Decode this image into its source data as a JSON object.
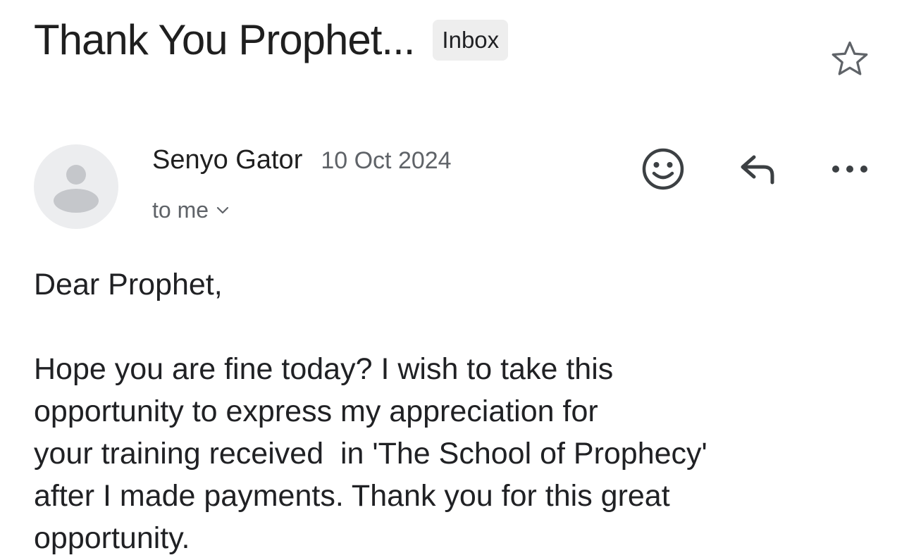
{
  "email": {
    "subject": "Thank You Prophet...",
    "label": "Inbox",
    "sender": {
      "name": "Senyo Gator",
      "date": "10 Oct 2024",
      "recipients": "to me"
    },
    "body": {
      "greeting": "Dear Prophet,",
      "lines": [
        "Hope you are fine today? I wish to take this",
        "opportunity to express my appreciation for",
        "your training received  in 'The School of Prophecy'",
        "after I made payments. Thank you for this great",
        "opportunity."
      ]
    }
  },
  "icons": {
    "star": "star-outline-icon",
    "avatar": "default-avatar-icon",
    "emoji": "add-reaction-icon",
    "reply": "reply-icon",
    "more": "more-horizontal-icon",
    "chevron": "chevron-down-icon"
  },
  "colors": {
    "text_primary": "#1f1f1f",
    "text_secondary": "#5f6368",
    "chip_background": "#eeeeee",
    "avatar_background": "#ecedef",
    "avatar_figure": "#c5c7cb"
  }
}
